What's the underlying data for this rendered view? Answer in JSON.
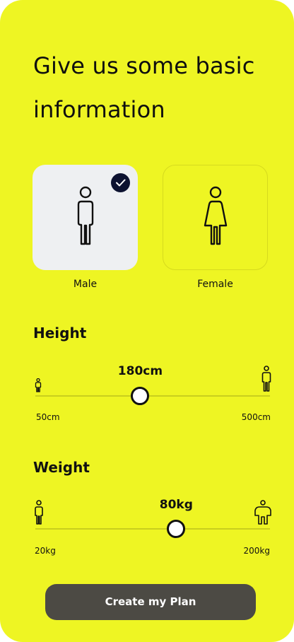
{
  "header": {
    "title": "Give us some basic information"
  },
  "gender": {
    "options": [
      {
        "label": "Male",
        "icon": "male-figure-icon",
        "selected": true
      },
      {
        "label": "Female",
        "icon": "female-figure-icon",
        "selected": false
      }
    ],
    "check_icon": "check-icon"
  },
  "height": {
    "title": "Height",
    "value_label": "180cm",
    "value": 180,
    "min_label": "50cm",
    "max_label": "500cm",
    "min": 50,
    "max": 500,
    "min_icon": "small-person-icon",
    "max_icon": "tall-person-icon"
  },
  "weight": {
    "title": "Weight",
    "value_label": "80kg",
    "value": 80,
    "min_label": "20kg",
    "max_label": "200kg",
    "min": 20,
    "max": 200,
    "min_icon": "thin-person-icon",
    "max_icon": "heavy-person-icon"
  },
  "cta": {
    "label": "Create my Plan"
  },
  "colors": {
    "background": "#eef523",
    "selected_tile": "#eef0f2",
    "check_badge": "#0c1230",
    "button": "#4c4a44",
    "track": "#c9cf1d"
  }
}
